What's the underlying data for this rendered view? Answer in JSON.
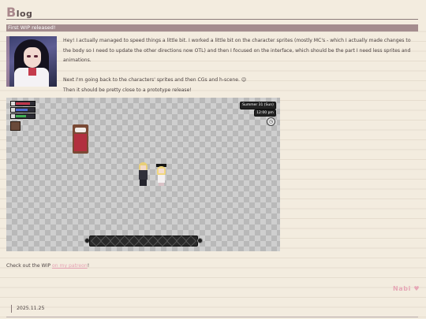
{
  "blog": {
    "title_initial": "B",
    "title_rest": "log"
  },
  "post": {
    "title": "First WIP released!",
    "paragraph1": "Hey! I actually managed to speed things a little bit. I worked a little bit on the character sprites (mostly MC's - which I actually made changes to the body so I need to update the other directions now OTL) and then I focused on the interface, which should be the part I need less sprites and animations.",
    "paragraph2_line1": "Next I'm going back to the characters' sprites and then CGs and h-scene. 😉",
    "paragraph2_line2": "Then it should be pretty close to a prototype release!",
    "footer_prefix": "Check out the WIP ",
    "footer_link": "on my patreon",
    "footer_suffix": "!",
    "author": "Nabi ♥",
    "date": "2025.11.25"
  },
  "game_ui": {
    "date": "Summer 31 (Sun)",
    "time": "12:00 pm",
    "stat_colors": [
      "#c0354a",
      "#4f6ad0",
      "#3fae52"
    ],
    "stat_levels": [
      0.8,
      0.7,
      0.6
    ],
    "icons": [
      "clock-icon",
      "chest-icon",
      "bed-icon"
    ]
  },
  "colors": {
    "banner": "#a48c8e",
    "link": "#e6a2b4",
    "background": "#f3ecdf"
  }
}
